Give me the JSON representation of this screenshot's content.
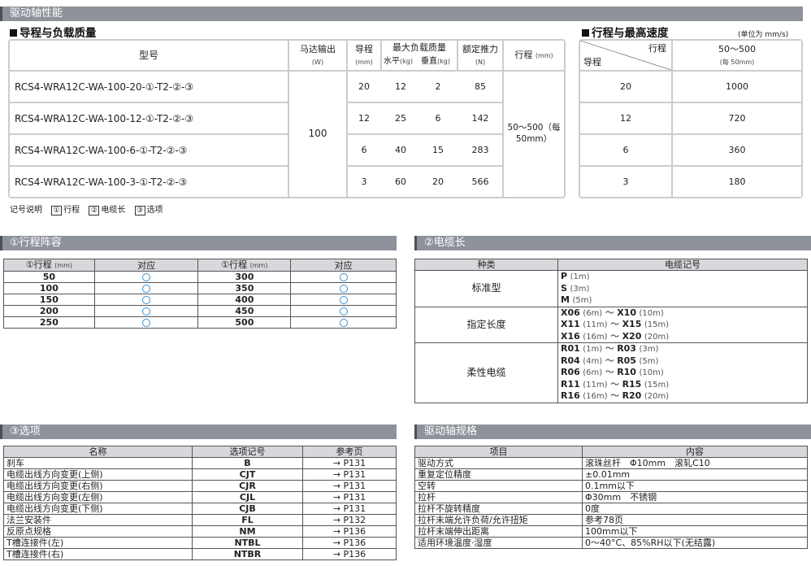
{
  "banner_top": "驱动轴性能",
  "lead_load": {
    "title": "导程与负载质量",
    "headers": {
      "model": "型号",
      "motor": "马达输出",
      "motor_unit": "(W)",
      "lead": "导程",
      "lead_unit": "(mm)",
      "max_load": "最大负载质量",
      "horizontal": "水平",
      "horizontal_unit": "(kg)",
      "vertical": "垂直",
      "vertical_unit": "(kg)",
      "thrust": "额定推力",
      "thrust_unit": "(N)",
      "stroke": "行程",
      "stroke_unit": "(mm)"
    },
    "motor_value": "100",
    "stroke_value": "50～500（每50mm）",
    "rows": [
      {
        "model": "RCS4-WRA12C-WA-100-20-①-T2-②-③",
        "lead": "20",
        "h": "12",
        "v": "2",
        "thrust": "85"
      },
      {
        "model": "RCS4-WRA12C-WA-100-12-①-T2-②-③",
        "lead": "12",
        "h": "25",
        "v": "6",
        "thrust": "142"
      },
      {
        "model": "RCS4-WRA12C-WA-100-6-①-T2-②-③",
        "lead": "6",
        "h": "40",
        "v": "15",
        "thrust": "283"
      },
      {
        "model": "RCS4-WRA12C-WA-100-3-①-T2-②-③",
        "lead": "3",
        "h": "60",
        "v": "20",
        "thrust": "566"
      }
    ]
  },
  "speed": {
    "title": "行程与最高速度",
    "unit_note": "(单位为 mm/s)",
    "stroke_label": "行程",
    "lead_label": "导程",
    "range": "50～500",
    "range_note": "(每 50mm)",
    "rows": [
      {
        "lead": "20",
        "speed": "1000"
      },
      {
        "lead": "12",
        "speed": "720"
      },
      {
        "lead": "6",
        "speed": "360"
      },
      {
        "lead": "3",
        "speed": "180"
      }
    ]
  },
  "legend": {
    "label": "记号说明",
    "i1": "①",
    "t1": "行程",
    "i2": "②",
    "t2": "电缆长",
    "i3": "③",
    "t3": "选项"
  },
  "stroke_list": {
    "banner": "①行程阵容",
    "col_stroke": "①行程",
    "col_unit": "(mm)",
    "col_support": "对应",
    "left": [
      "50",
      "100",
      "150",
      "200",
      "250"
    ],
    "right": [
      "300",
      "350",
      "400",
      "450",
      "500"
    ]
  },
  "cable": {
    "banner": "②电缆长",
    "col_type": "种类",
    "col_code": "电缆记号",
    "groups": [
      {
        "type": "标准型",
        "codes": [
          {
            "code": "P",
            "len": "(1m)"
          },
          {
            "code": "S",
            "len": "(3m)"
          },
          {
            "code": "M",
            "len": "(5m)"
          }
        ]
      },
      {
        "type": "指定长度",
        "codes": [
          {
            "code": "X06",
            "len": "(6m)",
            "code2": "X10",
            "len2": "(10m)"
          },
          {
            "code": "X11",
            "len": "(11m)",
            "code2": "X15",
            "len2": "(15m)"
          },
          {
            "code": "X16",
            "len": "(16m)",
            "code2": "X20",
            "len2": "(20m)"
          }
        ]
      },
      {
        "type": "柔性电缆",
        "codes": [
          {
            "code": "R01",
            "len": "(1m)",
            "code2": "R03",
            "len2": "(3m)"
          },
          {
            "code": "R04",
            "len": "(4m)",
            "code2": "R05",
            "len2": "(5m)"
          },
          {
            "code": "R06",
            "len": "(6m)",
            "code2": "R10",
            "len2": "(10m)"
          },
          {
            "code": "R11",
            "len": "(11m)",
            "code2": "R15",
            "len2": "(15m)"
          },
          {
            "code": "R16",
            "len": "(16m)",
            "code2": "R20",
            "len2": "(20m)"
          }
        ]
      }
    ],
    "tilde": "～"
  },
  "options": {
    "banner": "③选项",
    "col_name": "名称",
    "col_code": "选项记号",
    "col_page": "参考页",
    "rows": [
      {
        "name": "刹车",
        "code": "B",
        "page": "→ P131"
      },
      {
        "name": "电缆出线方向变更(上侧)",
        "code": "CJT",
        "page": "→ P131"
      },
      {
        "name": "电缆出线方向变更(右侧)",
        "code": "CJR",
        "page": "→ P131"
      },
      {
        "name": "电缆出线方向变更(左侧)",
        "code": "CJL",
        "page": "→ P131"
      },
      {
        "name": "电缆出线方向变更(下侧)",
        "code": "CJB",
        "page": "→ P131"
      },
      {
        "name": "法兰安装件",
        "code": "FL",
        "page": "→ P132"
      },
      {
        "name": "反原点规格",
        "code": "NM",
        "page": "→ P136"
      },
      {
        "name": "T槽连接件(左)",
        "code": "NTBL",
        "page": "→ P136"
      },
      {
        "name": "T槽连接件(右)",
        "code": "NTBR",
        "page": "→ P136"
      }
    ]
  },
  "spec": {
    "banner": "驱动轴规格",
    "col_item": "项目",
    "col_content": "内容",
    "rows": [
      {
        "item": "驱动方式",
        "content": "滚珠丝杆　Φ10mm　滚轧C10"
      },
      {
        "item": "重复定位精度",
        "content": "±0.01mm"
      },
      {
        "item": "空转",
        "content": "0.1mm以下"
      },
      {
        "item": "拉杆",
        "content": "Φ30mm　不锈钢"
      },
      {
        "item": "拉杆不旋转精度",
        "content": "0度"
      },
      {
        "item": "拉杆末端允许负荷/允许扭矩",
        "content": "参考78页"
      },
      {
        "item": "拉杆末端伸出距离",
        "content": "100mm以下"
      },
      {
        "item": "适用环境温度·湿度",
        "content": "0～40°C、85%RH以下(无结露)"
      }
    ]
  }
}
